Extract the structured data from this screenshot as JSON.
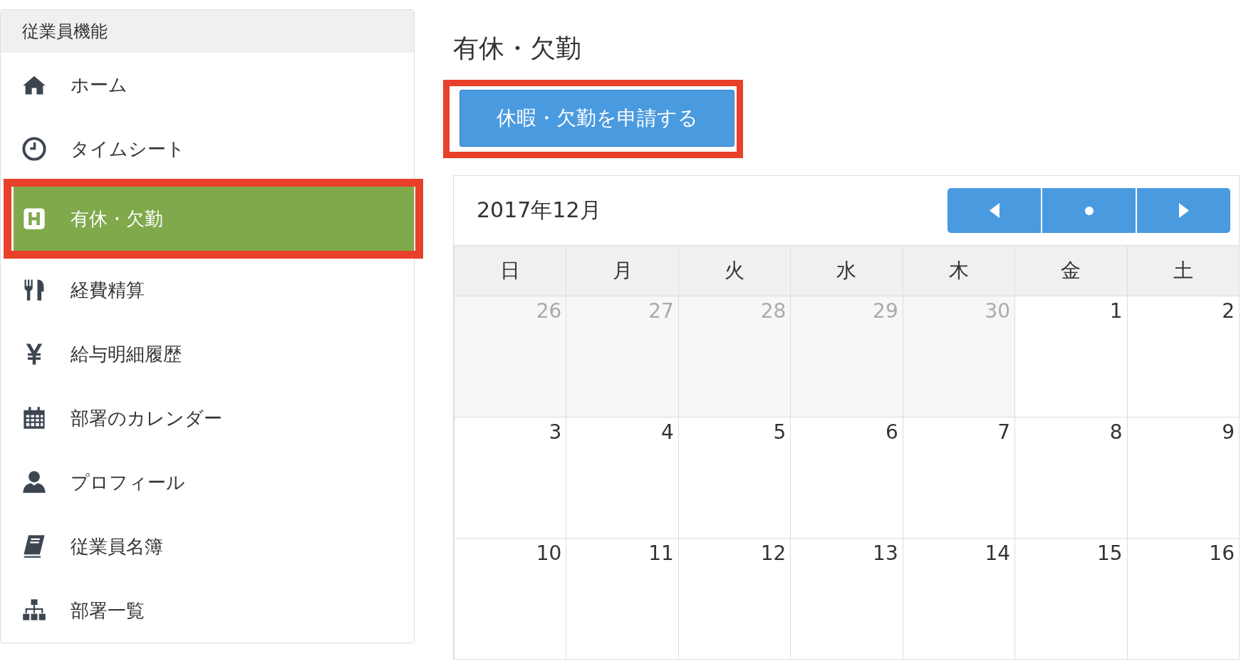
{
  "sidebar": {
    "header": "従業員機能",
    "items": [
      {
        "label": "ホーム",
        "selected": false,
        "annotated": false
      },
      {
        "label": "タイムシート",
        "selected": false,
        "annotated": false
      },
      {
        "label": "有休・欠勤",
        "selected": true,
        "annotated": true
      },
      {
        "label": "経費精算",
        "selected": false,
        "annotated": false
      },
      {
        "label": "給与明細履歴",
        "selected": false,
        "annotated": false
      },
      {
        "label": "部署のカレンダー",
        "selected": false,
        "annotated": false
      },
      {
        "label": "プロフィール",
        "selected": false,
        "annotated": false
      },
      {
        "label": "従業員名簿",
        "selected": false,
        "annotated": false
      },
      {
        "label": "部署一覧",
        "selected": false,
        "annotated": false
      }
    ]
  },
  "page_title": "有休・欠勤",
  "request_button": {
    "label": "休暇・欠勤を申請する",
    "annotated": true
  },
  "calendar": {
    "month": "2017年12月",
    "nav": [
      {
        "kind": "prev"
      },
      {
        "kind": "today"
      },
      {
        "kind": "next"
      }
    ],
    "weekdays": [
      "日",
      "月",
      "火",
      "水",
      "木",
      "金",
      "土"
    ],
    "weeks": [
      [
        {
          "day": "26",
          "outside": true
        },
        {
          "day": "27",
          "outside": true
        },
        {
          "day": "28",
          "outside": true
        },
        {
          "day": "29",
          "outside": true
        },
        {
          "day": "30",
          "outside": true
        },
        {
          "day": "1",
          "outside": false
        },
        {
          "day": "2",
          "outside": false
        }
      ],
      [
        {
          "day": "3",
          "outside": false
        },
        {
          "day": "4",
          "outside": false
        },
        {
          "day": "5",
          "outside": false
        },
        {
          "day": "6",
          "outside": false
        },
        {
          "day": "7",
          "outside": false
        },
        {
          "day": "8",
          "outside": false
        },
        {
          "day": "9",
          "outside": false
        }
      ],
      [
        {
          "day": "10",
          "outside": false
        },
        {
          "day": "11",
          "outside": false
        },
        {
          "day": "12",
          "outside": false
        },
        {
          "day": "13",
          "outside": false
        },
        {
          "day": "14",
          "outside": false
        },
        {
          "day": "15",
          "outside": false
        },
        {
          "day": "16",
          "outside": false
        }
      ]
    ]
  }
}
